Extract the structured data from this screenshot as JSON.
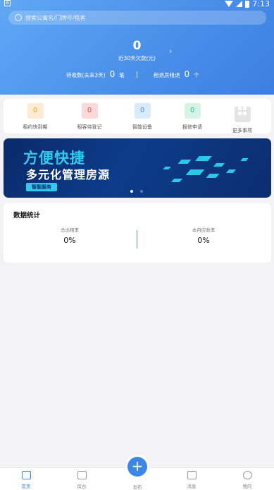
{
  "status_bar": {
    "time": "7:13",
    "left_icon": "A"
  },
  "search": {
    "placeholder": "搜索公寓名/门牌号/租客"
  },
  "arrears": {
    "value": "0",
    "label": "近30天欠款(元)"
  },
  "stats_row": {
    "pending_label": "待收数(未来3天)",
    "pending_value": "0",
    "pending_unit": "笔",
    "expiring_label": "租退房租退",
    "expiring_value": "0",
    "expiring_unit": "个"
  },
  "quick_menu": [
    {
      "label": "租约快到期",
      "value": "0",
      "icon": "count-badge-icon",
      "color": "#f5a623"
    },
    {
      "label": "租客待登记",
      "value": "0",
      "icon": "count-badge-icon",
      "color": "#e55353"
    },
    {
      "label": "智能设备",
      "value": "0",
      "icon": "count-badge-icon",
      "color": "#4a90ea"
    },
    {
      "label": "报修申请",
      "value": "0",
      "icon": "count-badge-icon",
      "color": "#2bbf8a"
    },
    {
      "label": "更多事项",
      "icon": "grid-icon",
      "color": "#c9c9c9"
    }
  ],
  "banner": {
    "title1": "方便快捷",
    "title2": "多元化管理房源",
    "tag": "智能服务"
  },
  "data_stats": {
    "title": "数据统计",
    "left_label": "总出租率",
    "left_value": "0%",
    "right_label": "本月应收率",
    "right_value": "0%"
  },
  "tabbar": {
    "home": "首页",
    "houses": "房台",
    "publish": "发布",
    "messages": "消息",
    "mine": "我的",
    "accent": "#3d85e6"
  }
}
